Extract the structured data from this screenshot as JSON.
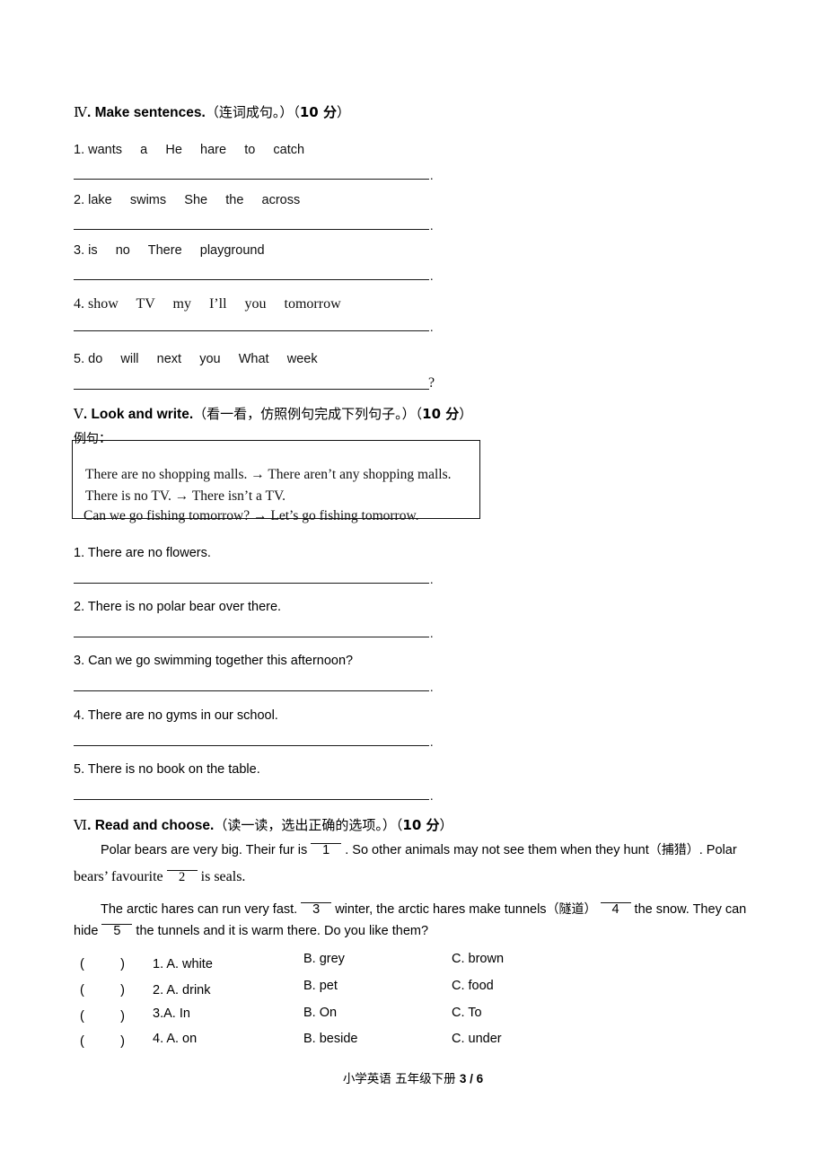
{
  "sections": {
    "make_sentences": {
      "roman": "Ⅳ",
      "title": ". Make sentences.",
      "chinese": "（连词成句。）",
      "score_open": "（",
      "score_num": "10",
      "score_unit": " 分",
      "score_close": "）",
      "items": [
        {
          "num": "1.",
          "words": "wants     a     He     hare     to     catch",
          "end": "."
        },
        {
          "num": "2.",
          "words": "lake     swims     She     the     across",
          "end": "."
        },
        {
          "num": "3.",
          "words": "is     no     There     playground",
          "end": "."
        },
        {
          "num": "4.",
          "words": "show     TV     my     I’ll     you     tomorrow",
          "end": "."
        },
        {
          "num": "5.",
          "words": "do     will     next     you     What     week",
          "end": "?"
        }
      ]
    },
    "look_and_write": {
      "roman": "Ⅴ",
      "title": ". Look and write.",
      "chinese": "（看一看，仿照例句完成下列句子。）",
      "score_open": "（",
      "score_num": "10",
      "score_unit": " 分",
      "score_close": "）",
      "example_label": "例句：",
      "examples": [
        "There are no shopping malls.  →  There aren’t any shopping malls.",
        "There is no TV.  →  There isn’t a TV.",
        "Can we go fishing tomorrow?  →  Let’s go fishing tomorrow."
      ],
      "items": [
        {
          "num": "1.",
          "text": "There are no flowers.",
          "end": "."
        },
        {
          "num": "2.",
          "text": "There is no polar bear over there.",
          "end": "."
        },
        {
          "num": "3.",
          "text": "Can we go swimming together this afternoon?",
          "end": "."
        },
        {
          "num": "4.",
          "text": "There are no gyms in our school.",
          "end": "."
        },
        {
          "num": "5.",
          "text": "There is no book on the table.",
          "end": "."
        }
      ]
    },
    "read_and_choose": {
      "roman": "Ⅵ",
      "title": ". Read and choose.",
      "chinese": "（读一读，选出正确的选项。）",
      "score_open": "（",
      "score_num": "10",
      "score_unit": " 分",
      "score_close": "）",
      "passage": {
        "p1_a": "Polar bears are very big. Their fur is",
        "p1_blank": "1",
        "p1_b": ". So other animals may not see them when they hunt",
        "p1_cn": "（捕猎）",
        "p1_c": ". Polar",
        "p2_a": "bears’ favourite",
        "p2_blank": "2",
        "p2_b": "is seals.",
        "p3_a": "The arctic hares can run very fast.",
        "p3_blank": "3",
        "p3_b": "winter, the arctic hares make tunnels",
        "p3_cn": "（隧道）",
        "p3_blank2": "4",
        "p3_c": "the snow. They can",
        "p4_a": "hide",
        "p4_blank": "5",
        "p4_b": "the tunnels and it is warm there. Do you like them?"
      },
      "choices": [
        {
          "paren": "(          )",
          "a": "1. A. white",
          "b": "B. grey",
          "c": "C. brown"
        },
        {
          "paren": "(          )",
          "a": "2. A. drink",
          "b": "B. pet",
          "c": "C. food"
        },
        {
          "paren": "(          )",
          "a": "3.A. In",
          "b": "B. On",
          "c": "C. To"
        },
        {
          "paren": "(          )",
          "a": "4. A. on",
          "b": "B. beside",
          "c": "C. under"
        }
      ]
    }
  },
  "footer": {
    "subject": "小学英语  五年级下册 ",
    "page": "3 / 6"
  }
}
